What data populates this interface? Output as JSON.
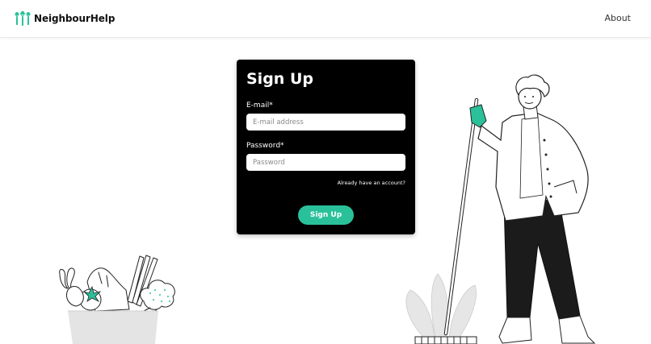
{
  "navbar": {
    "brand_name": "NeighbourHelp",
    "logo_icon": "people-group-logo-icon",
    "about_label": "About"
  },
  "signup": {
    "title": "Sign Up",
    "email_label": "E-mail*",
    "email_placeholder": "E-mail address",
    "email_value": "",
    "password_label": "Password*",
    "password_placeholder": "Password",
    "password_value": "",
    "login_link": "Already have an account?",
    "submit_label": "Sign Up"
  },
  "colors": {
    "accent": "#2ac19a",
    "card_background": "#000000",
    "page_background": "#ffffff"
  }
}
